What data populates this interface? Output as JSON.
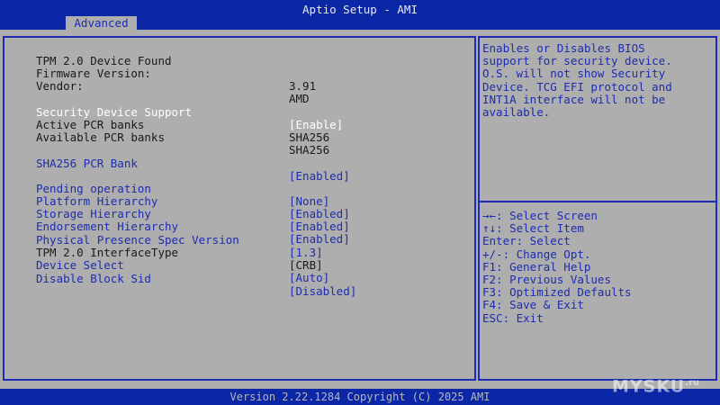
{
  "header": {
    "title": "Aptio Setup - AMI",
    "tab": "Advanced"
  },
  "settings": [
    {
      "label": "TPM 2.0 Device Found",
      "value": "",
      "style": "static"
    },
    {
      "label": "Firmware Version:",
      "value": "3.91",
      "style": "static"
    },
    {
      "label": "Vendor:",
      "value": "AMD",
      "style": "static"
    },
    {
      "label": "Security Device Support",
      "value": "[Enable]",
      "style": "selected"
    },
    {
      "label": "Active PCR banks",
      "value": "SHA256",
      "style": "static"
    },
    {
      "label": "Available PCR banks",
      "value": "SHA256",
      "style": "static"
    },
    {
      "label": "SHA256 PCR Bank",
      "value": "[Enabled]",
      "style": "option"
    },
    {
      "label": "Pending operation",
      "value": "[None]",
      "style": "option"
    },
    {
      "label": "Platform Hierarchy",
      "value": "[Enabled]",
      "style": "option"
    },
    {
      "label": "Storage Hierarchy",
      "value": "[Enabled]",
      "style": "option"
    },
    {
      "label": "Endorsement Hierarchy",
      "value": "[Enabled]",
      "style": "option"
    },
    {
      "label": "Physical Presence Spec Version",
      "value": "[1.3]",
      "style": "option"
    },
    {
      "label": "TPM 2.0 InterfaceType",
      "value": "[CRB]",
      "style": "static"
    },
    {
      "label": "Device Select",
      "value": "[Auto]",
      "style": "option"
    },
    {
      "label": "Disable Block Sid",
      "value": "[Disabled]",
      "style": "option"
    }
  ],
  "help": {
    "lines": [
      "Enables or Disables BIOS",
      "support for security device.",
      "O.S. will not show Security",
      "Device. TCG EFI protocol and",
      "INT1A interface will not be",
      "available."
    ]
  },
  "keys": [
    "→←: Select Screen",
    "↑↓: Select Item",
    "Enter: Select",
    "+/-: Change Opt.",
    "F1: General Help",
    "F2: Previous Values",
    "F3: Optimized Defaults",
    "F4: Save & Exit",
    "ESC: Exit"
  ],
  "footer": "Version 2.22.1284 Copyright (C) 2025 AMI",
  "watermark": {
    "text": "MYSKU",
    "suffix": ".ru"
  },
  "colors": {
    "header_bg": "#0b27a6",
    "body_bg": "#aeaeae",
    "accent": "#1d2cb0",
    "selected": "#ffffff"
  }
}
